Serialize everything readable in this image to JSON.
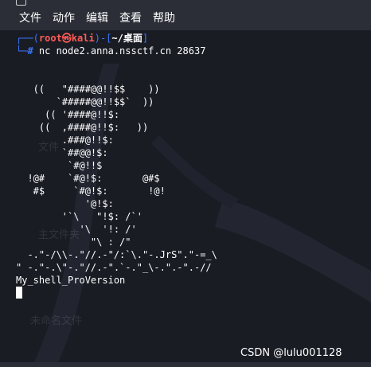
{
  "menu": {
    "items": [
      "文件",
      "动作",
      "编辑",
      "查看",
      "帮助"
    ]
  },
  "prompt": {
    "corner_top": "┌──(",
    "user": "root㉿kali",
    "bracket_close_open": ")-[",
    "dir": "~/桌面",
    "bracket_end": "]",
    "corner_bottom": "└─",
    "hash": "#",
    "command": " nc node2.anna.nssctf.cn 28637"
  },
  "output": {
    "lines": [
      "",
      "",
      "   ((   \"####@@!!$$    ))",
      "       `#####@@!!$$`  ))",
      "     (( '####@!!$:",
      "    ((  ,####@!!$:   ))",
      "        .###@!!$:",
      "        `##@@!$:",
      "         `#@!!$",
      "  !@#    `#@!$:       @#$",
      "   #$     `#@!$:       !@!",
      "            '@!$:",
      "        '`\\   \"!$: /`'",
      "           '\\  '!: /'",
      "             \"\\ : /\"",
      "  -.\"-/\\\\-.\"//.-\"/:`\\.\"-.JrS\".\"-=_\\",
      "\" -.\"-.\\\"-.\"//.-\".`-.\"_\\-.\".-\".-//",
      "My_shell_ProVersion"
    ]
  },
  "desktop_labels": [
    "文件",
    "主文件夹",
    "未命名文件"
  ],
  "watermark": "CSDN @lulu001128",
  "colors": {
    "terminal_bg": "#1a1c24",
    "prompt_blue": "#3b78ff",
    "prompt_red": "#ff5c57"
  }
}
